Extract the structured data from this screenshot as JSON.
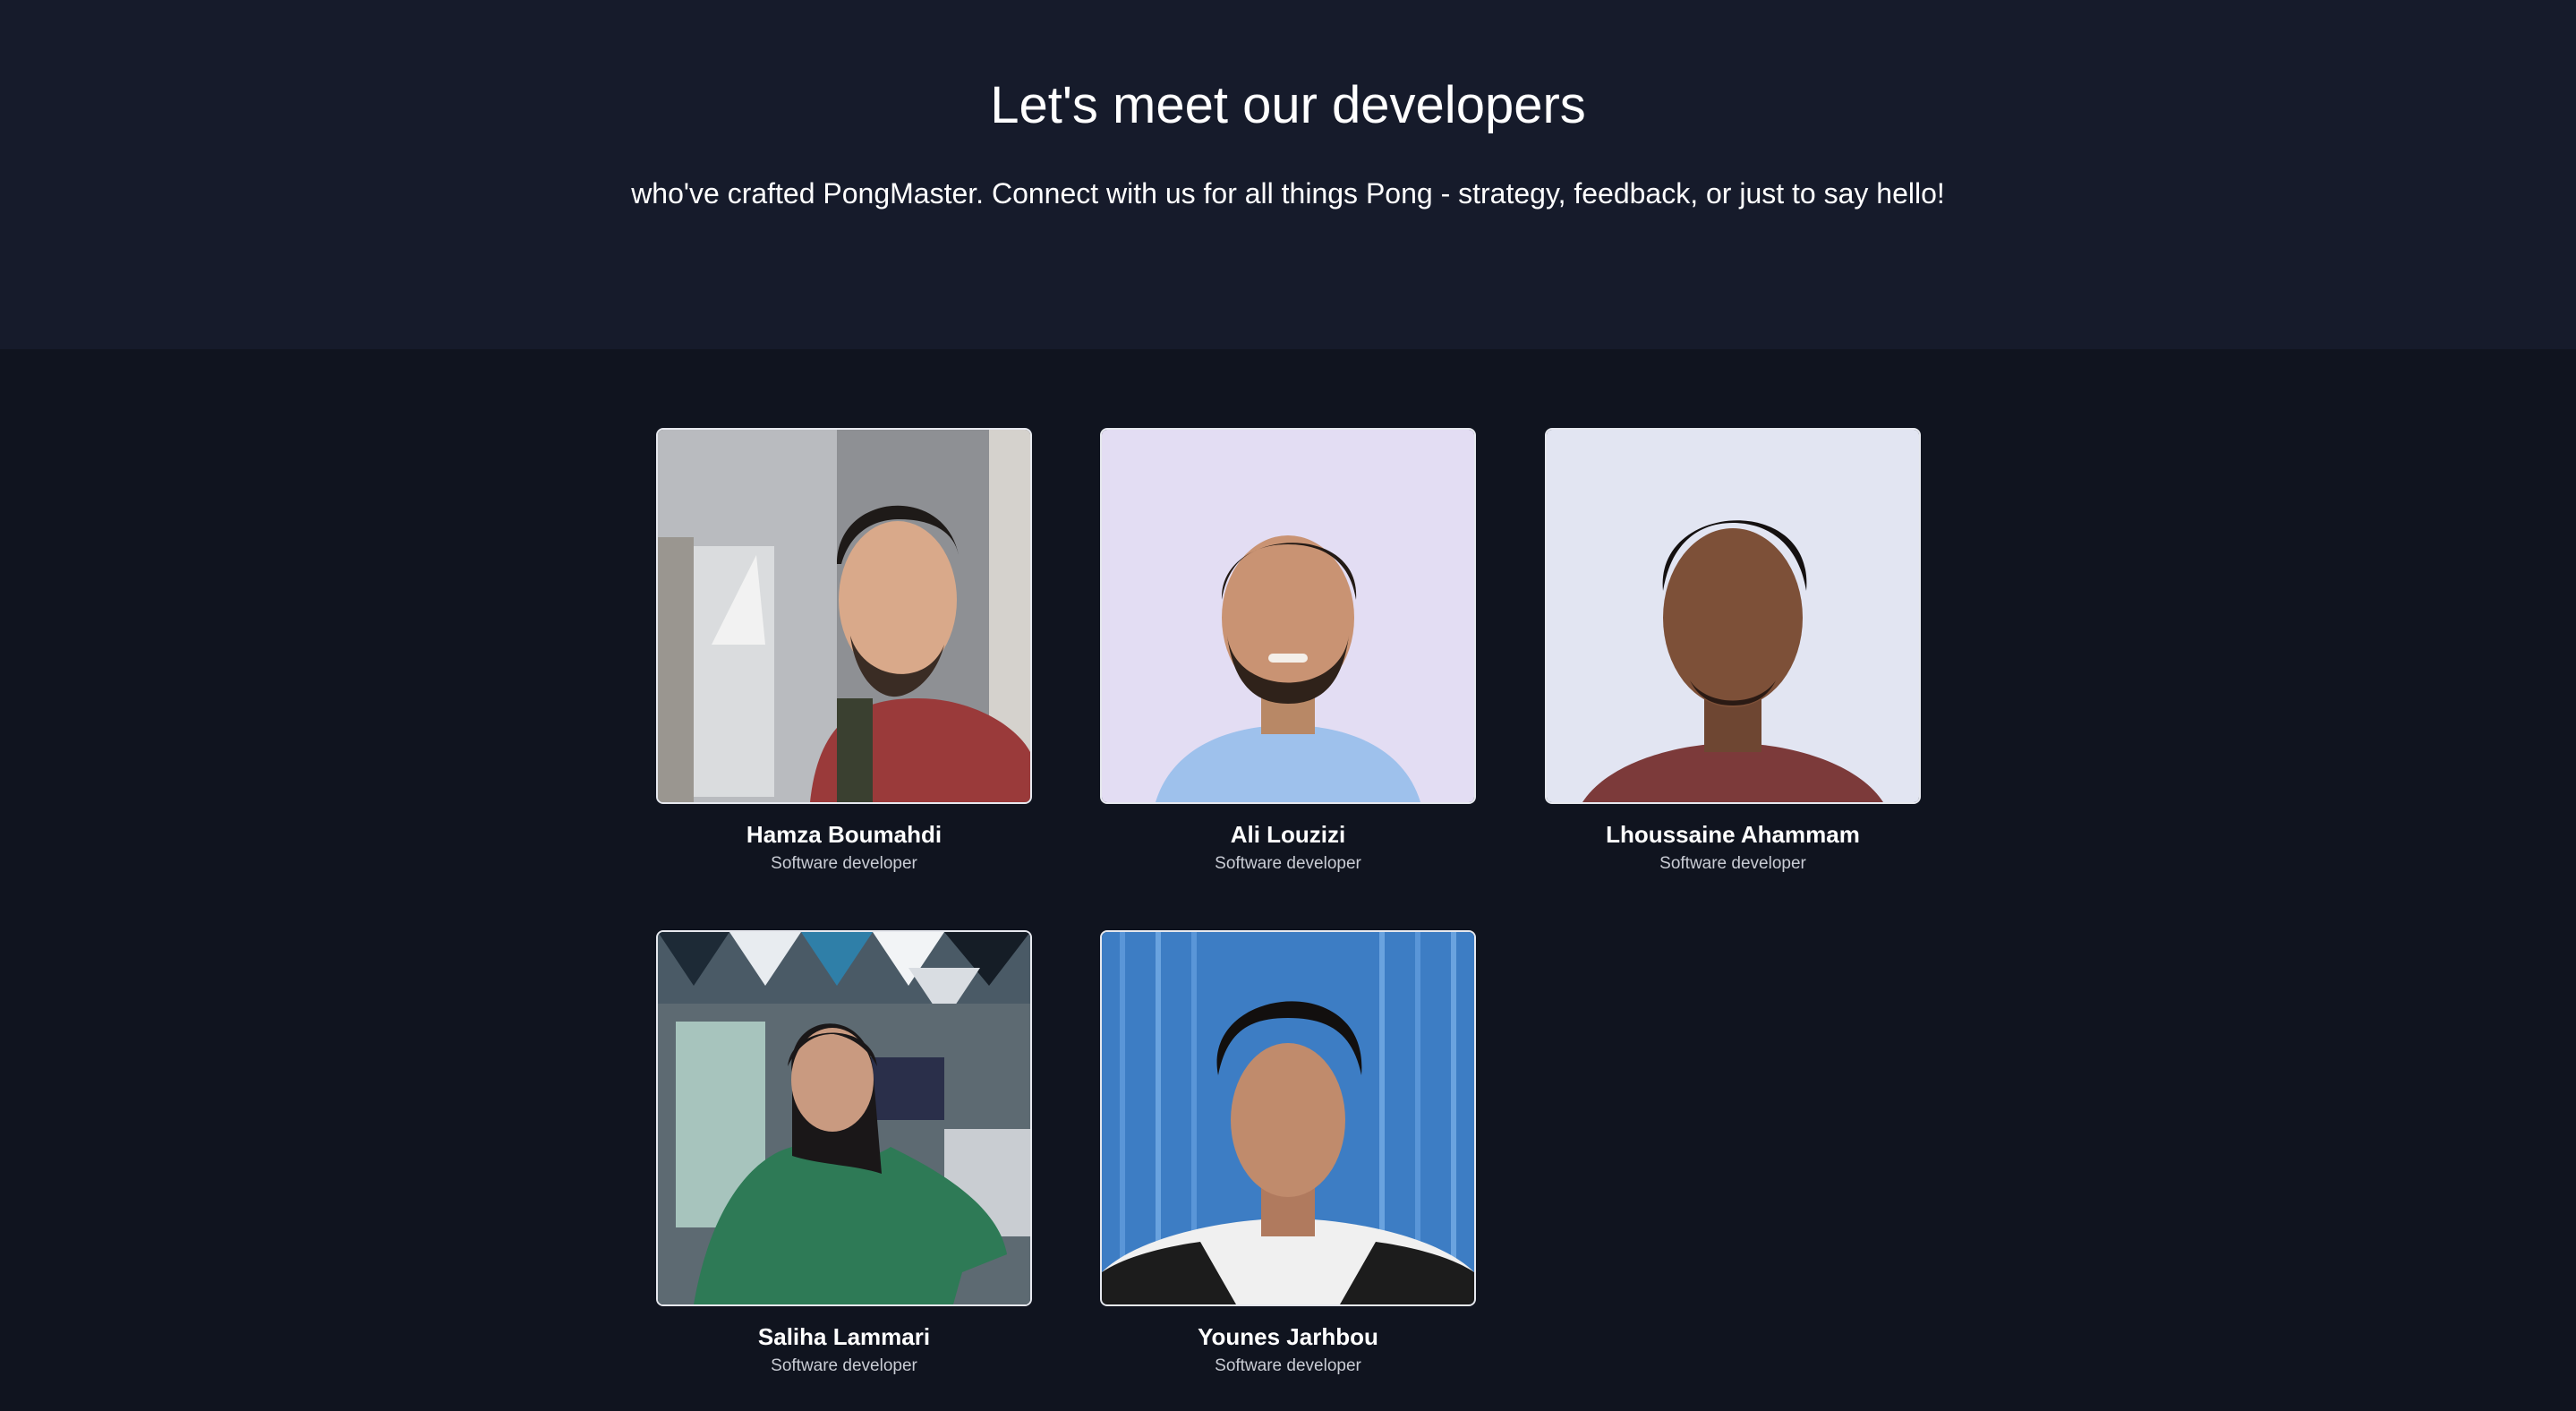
{
  "hero": {
    "title": "Let's meet our developers",
    "subtitle": "who've crafted PongMaster. Connect with us for all things Pong - strategy, feedback, or just to say hello!"
  },
  "developers": [
    {
      "name": "Hamza Boumahdi",
      "role": "Software developer"
    },
    {
      "name": "Ali Louzizi",
      "role": "Software developer"
    },
    {
      "name": "Lhoussaine Ahammam",
      "role": "Software developer"
    },
    {
      "name": "Saliha Lammari",
      "role": "Software developer"
    },
    {
      "name": "Younes Jarhbou",
      "role": "Software developer"
    }
  ],
  "colors": {
    "hero_background": "#161b2b",
    "page_background": "#10141f",
    "text": "#ffffff",
    "muted_text": "#c9ccd4"
  }
}
